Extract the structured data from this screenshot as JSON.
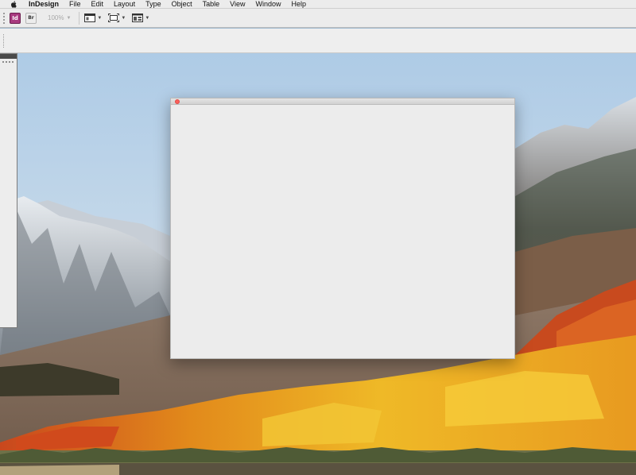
{
  "menubar": {
    "apple_icon": "apple-logo-icon",
    "app_name": "InDesign",
    "items": [
      "File",
      "Edit",
      "Layout",
      "Type",
      "Object",
      "Table",
      "View",
      "Window",
      "Help"
    ]
  },
  "controlbar": {
    "app_badge_id": "Id",
    "app_badge_bridge": "Br",
    "zoom_value": "100%",
    "view_options_icon": "view-options-icon",
    "screen_mode_icon": "screen-mode-icon",
    "arrange_documents_icon": "arrange-documents-icon"
  },
  "colors": {
    "indesign_brand": "#a83a7f",
    "close_button": "#fc605c"
  }
}
